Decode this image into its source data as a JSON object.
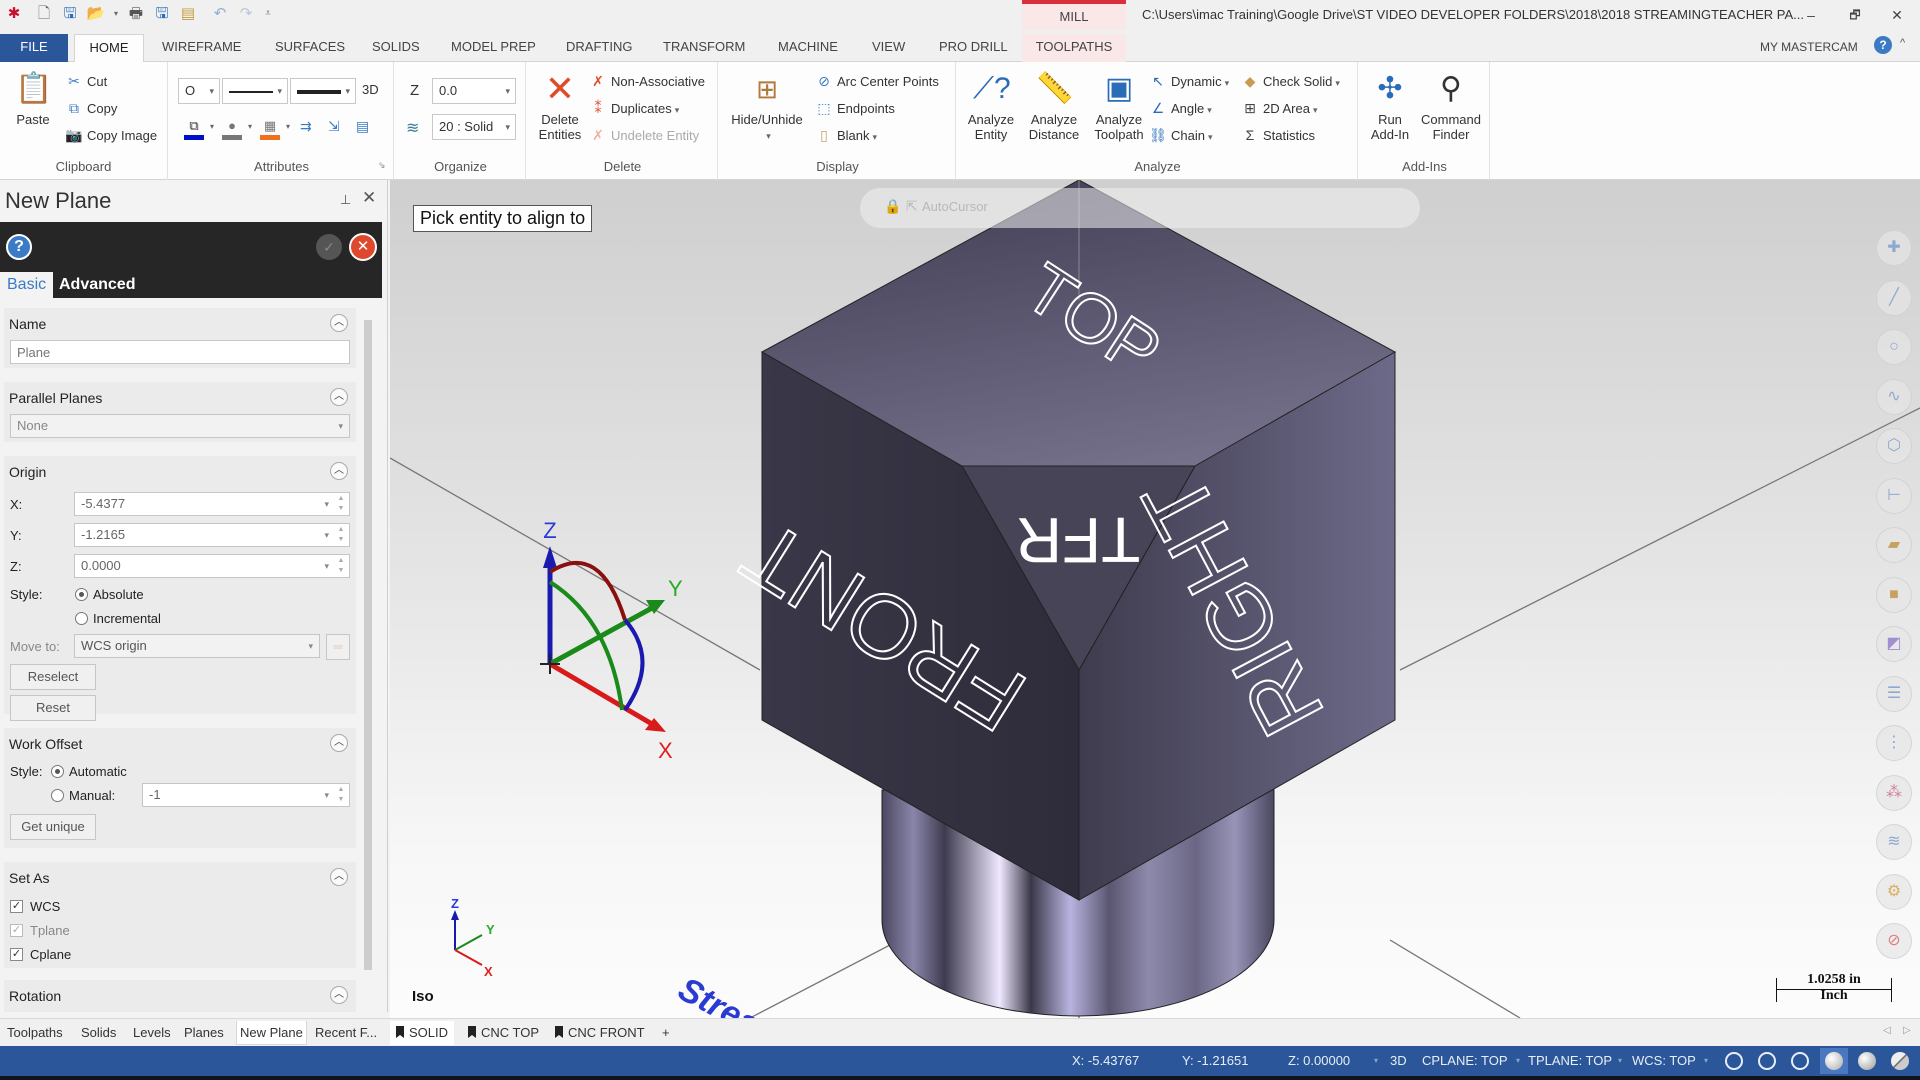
{
  "titlebar": {
    "quick_access": [
      "app-logo-icon",
      "new-file-icon",
      "save-icon",
      "open-icon",
      "print-icon",
      "save-as-icon",
      "zip2go-icon",
      "undo-icon",
      "redo-icon",
      "customize-icon"
    ],
    "context_tab": "MILL",
    "window_title": "C:\\Users\\imac Training\\Google Drive\\ST VIDEO DEVELOPER FOLDERS\\2018\\2018 STREAMINGTEACHER PA...",
    "controls": {
      "minimize": "–",
      "restore": "🗗",
      "close": "✕"
    }
  },
  "menu_tabs": {
    "file": "FILE",
    "items": [
      "HOME",
      "WIREFRAME",
      "SURFACES",
      "SOLIDS",
      "MODEL PREP",
      "DRAFTING",
      "TRANSFORM",
      "MACHINE",
      "VIEW",
      "PRO DRILL",
      "TOOLPATHS"
    ],
    "active": "HOME",
    "my_mastercam": "MY MASTERCAM"
  },
  "ribbon": {
    "clipboard": {
      "label": "Clipboard",
      "paste": "Paste",
      "cut": "Cut",
      "copy": "Copy",
      "copy_image": "Copy Image"
    },
    "attributes": {
      "label": "Attributes",
      "point_style": "O",
      "mode_3d": "3D"
    },
    "organize": {
      "label": "Organize",
      "z_label": "Z",
      "z_value": "0.0",
      "level_value": "20 : Solid"
    },
    "delete": {
      "label": "Delete",
      "delete_entities": "Delete Entities",
      "non_associative": "Non-Associative",
      "duplicates": "Duplicates",
      "undelete_entity": "Undelete Entity"
    },
    "display": {
      "label": "Display",
      "hide_unhide": "Hide/Unhide",
      "arc_center_points": "Arc Center Points",
      "endpoints": "Endpoints",
      "blank": "Blank"
    },
    "analyze": {
      "label": "Analyze",
      "analyze_entity": "Analyze Entity",
      "analyze_distance": "Analyze Distance",
      "analyze_toolpath": "Analyze Toolpath",
      "dynamic": "Dynamic",
      "angle": "Angle",
      "chain": "Chain",
      "check_solid": "Check Solid",
      "area_2d": "2D Area",
      "statistics": "Statistics"
    },
    "addins": {
      "label": "Add-Ins",
      "run_addin": "Run Add-In",
      "command_finder": "Command Finder"
    }
  },
  "panel": {
    "title": "New Plane",
    "tabs": [
      "Basic",
      "Advanced"
    ],
    "active_tab": "Basic",
    "name_section": {
      "title": "Name",
      "placeholder": "Plane",
      "value": ""
    },
    "parallel_section": {
      "title": "Parallel Planes",
      "value": "None"
    },
    "origin_section": {
      "title": "Origin",
      "x_label": "X:",
      "x_value": "-5.4377",
      "y_label": "Y:",
      "y_value": "-1.2165",
      "z_label": "Z:",
      "z_value": "0.0000",
      "style_label": "Style:",
      "absolute": "Absolute",
      "incremental": "Incremental",
      "style_selected": "Absolute",
      "move_to_label": "Move to:",
      "move_to_value": "WCS origin",
      "reselect": "Reselect",
      "reset": "Reset"
    },
    "work_offset_section": {
      "title": "Work Offset",
      "style_label": "Style:",
      "automatic": "Automatic",
      "manual": "Manual:",
      "manual_value": "-1",
      "style_selected": "Automatic",
      "get_unique": "Get unique"
    },
    "set_as_section": {
      "title": "Set As",
      "items": [
        {
          "label": "WCS",
          "checked": true,
          "enabled": true
        },
        {
          "label": "Tplane",
          "checked": true,
          "enabled": false
        },
        {
          "label": "Cplane",
          "checked": true,
          "enabled": true
        }
      ]
    },
    "rotation_section": {
      "title": "Rotation"
    }
  },
  "bottom_tabs": {
    "managers": [
      "Toolpaths",
      "Solids",
      "Levels",
      "Planes",
      "New Plane",
      "Recent F..."
    ],
    "active_manager": "New Plane",
    "viewsheets": [
      "SOLID",
      "CNC TOP",
      "CNC FRONT"
    ],
    "active_viewsheet": "SOLID",
    "add": "+"
  },
  "viewport": {
    "prompt": "Pick entity to align to",
    "autocursor": "AutoCursor",
    "view_label": "Iso",
    "scale_value": "1.0258 in",
    "scale_unit": "Inch",
    "cube_faces": {
      "top": "TOP",
      "front": "FRONT",
      "right": "RIGHT",
      "corner": "TFR"
    },
    "gnomon_axes": {
      "x": "X",
      "y": "Y",
      "z": "Z"
    },
    "watermark": "Streaming",
    "right_toolbar": [
      "point-icon",
      "line-icon",
      "circle-icon",
      "spline-icon",
      "solid-icon",
      "dimension-icon",
      "measure-icon",
      "box-icon",
      "transform-icon",
      "manager-icon",
      "list-icon",
      "color-icon",
      "layers-icon",
      "settings-icon",
      "clear-icon"
    ]
  },
  "statusbar": {
    "x": "X:  -5.43767",
    "y": "Y:  -1.21651",
    "z": "Z:  0.00000",
    "mode": "3D",
    "cplane": "CPLANE: TOP",
    "tplane": "TPLANE: TOP",
    "wcs": "WCS: TOP"
  },
  "colors": {
    "file_tab": "#2b579a",
    "statusbar": "#2b579a",
    "context_mill": "#d9313c",
    "cube": "#4a4860",
    "axis_x": "#e02020",
    "axis_y": "#1a9a1a",
    "axis_z": "#1a1ab0"
  }
}
